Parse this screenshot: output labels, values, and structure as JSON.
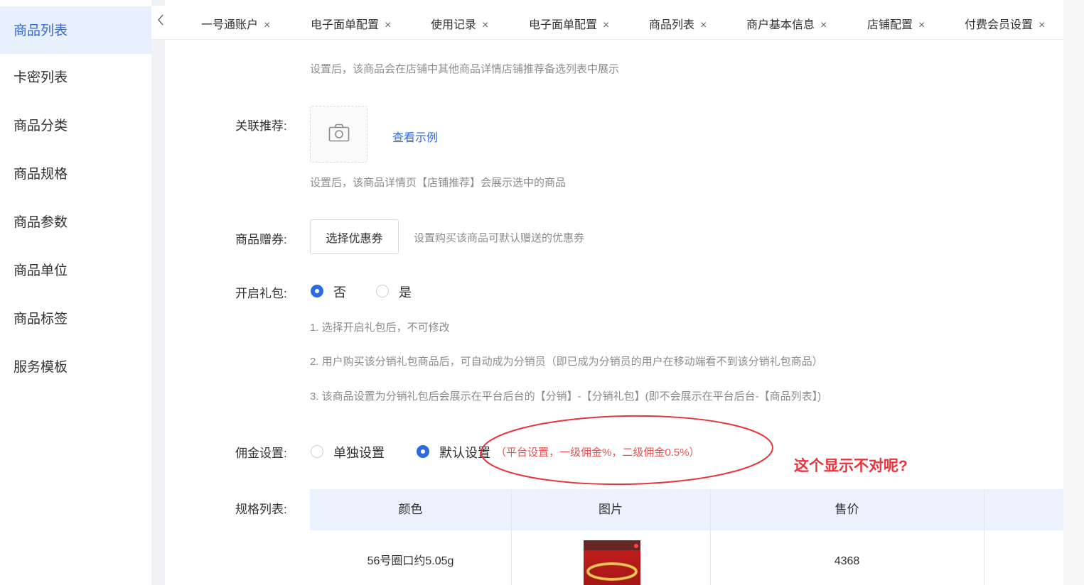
{
  "sidebar": {
    "items": [
      {
        "label": "商品列表",
        "active": true
      },
      {
        "label": "卡密列表"
      },
      {
        "label": "商品分类"
      },
      {
        "label": "商品规格"
      },
      {
        "label": "商品参数"
      },
      {
        "label": "商品单位"
      },
      {
        "label": "商品标签"
      },
      {
        "label": "服务模板"
      }
    ]
  },
  "tabs": [
    {
      "label": "一号通账户"
    },
    {
      "label": "电子面单配置"
    },
    {
      "label": "使用记录"
    },
    {
      "label": "电子面单配置"
    },
    {
      "label": "商品列表"
    },
    {
      "label": "商户基本信息"
    },
    {
      "label": "店铺配置"
    },
    {
      "label": "付费会员设置"
    }
  ],
  "tab_close_symbol": "×",
  "form": {
    "top_hint": "设置后，该商品会在店铺中其他商品详情店铺推荐备选列表中展示",
    "related_label": "关联推荐:",
    "related_example_link": "查看示例",
    "related_hint": "设置后，该商品详情页【店铺推荐】会展示选中的商品",
    "coupon_label": "商品赠券:",
    "coupon_button": "选择优惠券",
    "coupon_hint": "设置购买该商品可默认赠送的优惠券",
    "gift_label": "开启礼包:",
    "gift_options": [
      {
        "label": "否",
        "checked": true
      },
      {
        "label": "是",
        "checked": false
      }
    ],
    "gift_notes": [
      "1. 选择开启礼包后，不可修改",
      "2. 用户购买该分销礼包商品后，可自动成为分销员（即已成为分销员的用户在移动端看不到该分销礼包商品）",
      "3. 该商品设置为分销礼包后会展示在平台后台的【分销】-【分销礼包】(即不会展示在平台后台-【商品列表】)"
    ],
    "commission_label": "佣金设置:",
    "commission_options": [
      {
        "label": "单独设置",
        "checked": false
      },
      {
        "label": "默认设置",
        "checked": true
      }
    ],
    "commission_note": "（平台设置，一级佣金%，二级佣金0.5%）",
    "spec_label": "规格列表:"
  },
  "annotation": {
    "text": "这个显示不对呢?",
    "color": "#e8323c"
  },
  "spec_table": {
    "headers": [
      "颜色",
      "图片",
      "售价"
    ],
    "rows": [
      {
        "color": "56号圈口约5.05g",
        "price": "4368"
      }
    ]
  },
  "colors": {
    "accent": "#2d6ae3",
    "active_bg": "#e8f0fe",
    "table_header_bg": "#ebf1fd",
    "warning": "#e55555"
  }
}
